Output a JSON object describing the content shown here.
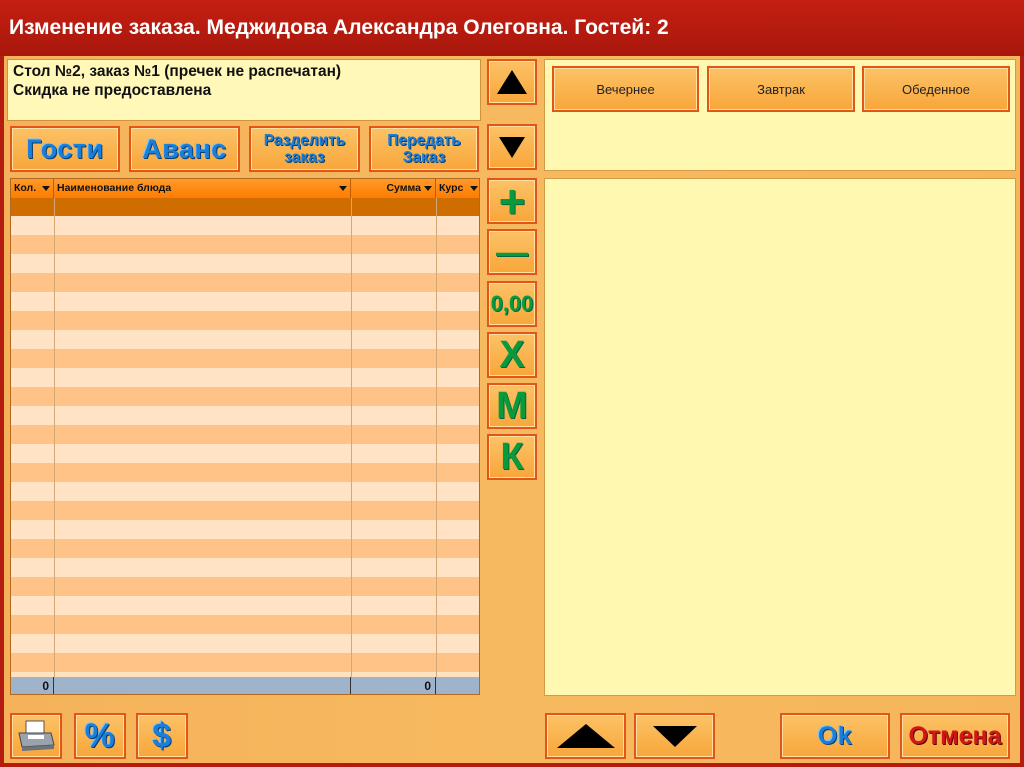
{
  "window": {
    "title": "Изменение заказа. Меджидова Александра Олеговна. Гостей: 2"
  },
  "order_info": {
    "line1": "Стол №2, заказ №1 (пречек не распечатан)",
    "line2": "Скидка не предоставлена"
  },
  "action_buttons": {
    "guests": "Гости",
    "advance": "Аванс",
    "split_1": "Разделить",
    "split_2": "заказ",
    "transfer_1": "Передать",
    "transfer_2": "Заказ"
  },
  "grid": {
    "columns": [
      "Кол.",
      "Наименование блюда",
      "Сумма",
      "Курс"
    ],
    "rows": [],
    "footer": {
      "qty_total": "0",
      "sum_total": "0"
    }
  },
  "side_buttons": {
    "plus": "+",
    "minus": "—",
    "price": "0,00",
    "x": "X",
    "m": "M",
    "k": "К"
  },
  "menus": [
    "Вечернее",
    "Завтрак",
    "Обеденное"
  ],
  "bottom": {
    "percent": "%",
    "dollar": "$",
    "ok": "Ok",
    "cancel": "Отмена"
  },
  "icons": [
    "printer-icon",
    "arrow-up-icon",
    "arrow-down-icon"
  ]
}
